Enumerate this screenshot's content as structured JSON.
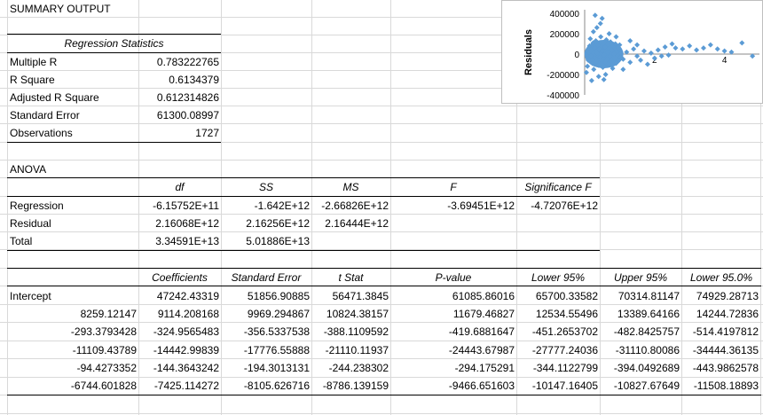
{
  "summary_title": "SUMMARY OUTPUT",
  "regression_stats": {
    "header": "Regression Statistics",
    "rows": [
      {
        "label": "Multiple R",
        "value": "0.783222765"
      },
      {
        "label": "R Square",
        "value": "0.6134379"
      },
      {
        "label": "Adjusted R Square",
        "value": "0.612314826"
      },
      {
        "label": "Standard Error",
        "value": "61300.08997"
      },
      {
        "label": "Observations",
        "value": "1727"
      }
    ]
  },
  "anova": {
    "title": "ANOVA",
    "headers": [
      "df",
      "SS",
      "MS",
      "F",
      "Significance F"
    ],
    "rows": [
      {
        "label": "Regression",
        "df": "-6.15752E+11",
        "ss": "-1.642E+12",
        "ms": "-2.66826E+12",
        "f": "-3.69451E+12",
        "sigf": "-4.72076E+12"
      },
      {
        "label": "Residual",
        "df": "2.16068E+12",
        "ss": "2.16256E+12",
        "ms": "2.16444E+12",
        "f": "",
        "sigf": ""
      },
      {
        "label": "Total",
        "df": "3.34591E+13",
        "ss": "5.01886E+13",
        "ms": "",
        "f": "",
        "sigf": ""
      }
    ]
  },
  "coefficients": {
    "headers": [
      "Coefficients",
      "Standard Error",
      "t Stat",
      "P-value",
      "Lower 95%",
      "Upper 95%",
      "Lower 95.0%"
    ],
    "rows": [
      [
        "Intercept",
        "47242.43319",
        "51856.90885",
        "56471.3845",
        "61085.86016",
        "65700.33582",
        "70314.81147",
        "74929.28713"
      ],
      [
        "8259.12147",
        "9114.208168",
        "9969.294867",
        "10824.38157",
        "11679.46827",
        "12534.55496",
        "13389.64166",
        "14244.72836"
      ],
      [
        "-293.3793428",
        "-324.9565483",
        "-356.5337538",
        "-388.1109592",
        "-419.6881647",
        "-451.2653702",
        "-482.8425757",
        "-514.4197812"
      ],
      [
        "-11109.43789",
        "-14442.99839",
        "-17776.55888",
        "-21110.11937",
        "-24443.67987",
        "-27777.24036",
        "-31110.80086",
        "-34444.36135"
      ],
      [
        "-94.4273352",
        "-144.3643242",
        "-194.3013131",
        "-244.238302",
        "-294.175291",
        "-344.1122799",
        "-394.0492689",
        "-443.9862578"
      ],
      [
        "-6744.601828",
        "-7425.114272",
        "-8105.626716",
        "-8786.139159",
        "-9466.651603",
        "-10147.16405",
        "-10827.67649",
        "-11508.18893"
      ]
    ]
  },
  "chart_data": {
    "type": "scatter",
    "title": "",
    "xlabel": "",
    "ylabel": "Residuals",
    "xlim": [
      0,
      5
    ],
    "ylim": [
      -400000,
      400000
    ],
    "x_ticks": [
      "2",
      "4"
    ],
    "y_ticks": [
      "400000",
      "200000",
      "0",
      "-200000",
      "-400000"
    ],
    "marker_color": "#5b9bd5",
    "points": [
      {
        "x": 0.05,
        "y": -180000
      },
      {
        "x": 0.08,
        "y": -120000
      },
      {
        "x": 0.1,
        "y": -60000
      },
      {
        "x": 0.12,
        "y": 20000
      },
      {
        "x": 0.14,
        "y": 80000
      },
      {
        "x": 0.16,
        "y": 150000
      },
      {
        "x": 0.18,
        "y": -20000
      },
      {
        "x": 0.2,
        "y": 40000
      },
      {
        "x": 0.22,
        "y": -90000
      },
      {
        "x": 0.24,
        "y": 110000
      },
      {
        "x": 0.26,
        "y": -150000
      },
      {
        "x": 0.28,
        "y": 60000
      },
      {
        "x": 0.3,
        "y": -40000
      },
      {
        "x": 0.32,
        "y": 130000
      },
      {
        "x": 0.34,
        "y": -70000
      },
      {
        "x": 0.36,
        "y": 10000
      },
      {
        "x": 0.38,
        "y": 90000
      },
      {
        "x": 0.4,
        "y": -110000
      },
      {
        "x": 0.42,
        "y": 50000
      },
      {
        "x": 0.44,
        "y": -30000
      },
      {
        "x": 0.46,
        "y": 170000
      },
      {
        "x": 0.48,
        "y": -60000
      },
      {
        "x": 0.5,
        "y": 30000
      },
      {
        "x": 0.52,
        "y": -130000
      },
      {
        "x": 0.54,
        "y": 100000
      },
      {
        "x": 0.56,
        "y": -10000
      },
      {
        "x": 0.58,
        "y": 70000
      },
      {
        "x": 0.6,
        "y": -80000
      },
      {
        "x": 0.62,
        "y": 140000
      },
      {
        "x": 0.64,
        "y": -50000
      },
      {
        "x": 0.66,
        "y": 20000
      },
      {
        "x": 0.68,
        "y": -100000
      },
      {
        "x": 0.7,
        "y": 60000
      },
      {
        "x": 0.72,
        "y": -20000
      },
      {
        "x": 0.74,
        "y": 120000
      },
      {
        "x": 0.76,
        "y": -70000
      },
      {
        "x": 0.78,
        "y": 40000
      },
      {
        "x": 0.8,
        "y": -140000
      },
      {
        "x": 0.82,
        "y": 80000
      },
      {
        "x": 0.84,
        "y": 0
      },
      {
        "x": 0.86,
        "y": -40000
      },
      {
        "x": 0.88,
        "y": 100000
      },
      {
        "x": 0.9,
        "y": -90000
      },
      {
        "x": 0.92,
        "y": 30000
      },
      {
        "x": 0.94,
        "y": -20000
      },
      {
        "x": 0.96,
        "y": 60000
      },
      {
        "x": 0.98,
        "y": -60000
      },
      {
        "x": 1.0,
        "y": 90000
      },
      {
        "x": 1.02,
        "y": -30000
      },
      {
        "x": 1.04,
        "y": 10000
      },
      {
        "x": 0.25,
        "y": 220000
      },
      {
        "x": 0.35,
        "y": 260000
      },
      {
        "x": 0.45,
        "y": 300000
      },
      {
        "x": 0.5,
        "y": 350000
      },
      {
        "x": 0.3,
        "y": 380000
      },
      {
        "x": 0.4,
        "y": -220000
      },
      {
        "x": 0.55,
        "y": -250000
      },
      {
        "x": 0.2,
        "y": -260000
      },
      {
        "x": 0.6,
        "y": -200000
      },
      {
        "x": 0.7,
        "y": 200000
      },
      {
        "x": 1.1,
        "y": -50000
      },
      {
        "x": 1.2,
        "y": 20000
      },
      {
        "x": 1.3,
        "y": -80000
      },
      {
        "x": 1.4,
        "y": 50000
      },
      {
        "x": 1.5,
        "y": -20000
      },
      {
        "x": 1.6,
        "y": -60000
      },
      {
        "x": 1.7,
        "y": 30000
      },
      {
        "x": 1.8,
        "y": -100000
      },
      {
        "x": 1.9,
        "y": 10000
      },
      {
        "x": 2.0,
        "y": -40000
      },
      {
        "x": 2.1,
        "y": 40000
      },
      {
        "x": 2.2,
        "y": -20000
      },
      {
        "x": 2.3,
        "y": 70000
      },
      {
        "x": 2.4,
        "y": -10000
      },
      {
        "x": 2.6,
        "y": 60000
      },
      {
        "x": 2.8,
        "y": 50000
      },
      {
        "x": 3.0,
        "y": 80000
      },
      {
        "x": 3.2,
        "y": 40000
      },
      {
        "x": 3.4,
        "y": 60000
      },
      {
        "x": 3.6,
        "y": 90000
      },
      {
        "x": 3.8,
        "y": 50000
      },
      {
        "x": 4.0,
        "y": 30000
      },
      {
        "x": 4.2,
        "y": 20000
      },
      {
        "x": 4.5,
        "y": 110000
      },
      {
        "x": 4.8,
        "y": -20000
      },
      {
        "x": 1.5,
        "y": 90000
      },
      {
        "x": 2.5,
        "y": 100000
      },
      {
        "x": 1.3,
        "y": 130000
      },
      {
        "x": 0.9,
        "y": 170000
      },
      {
        "x": 1.1,
        "y": -150000
      }
    ]
  }
}
